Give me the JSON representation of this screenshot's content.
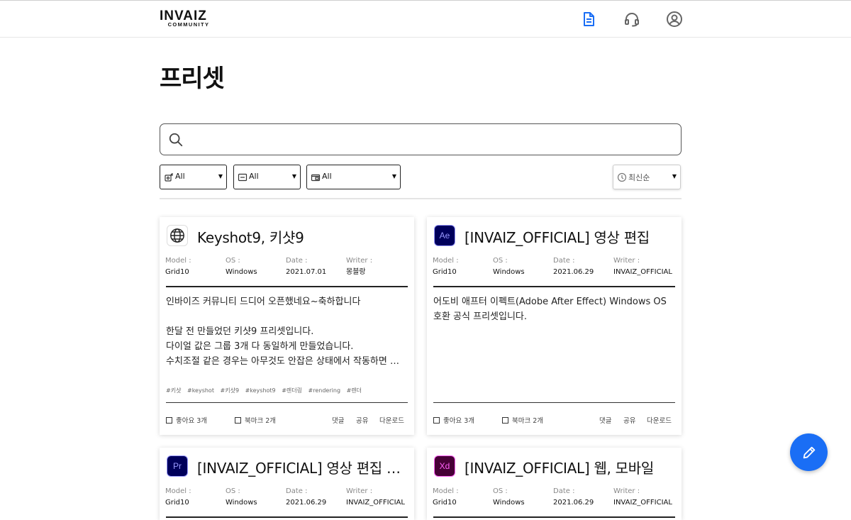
{
  "header": {
    "logo_main": "INVAIZ",
    "logo_sub": "COMMUNITY",
    "icons": [
      "document-icon",
      "headset-icon",
      "user-icon"
    ],
    "accent_color": "#1a6ef5"
  },
  "page": {
    "title": "프리셋"
  },
  "search": {
    "value": "",
    "placeholder": "",
    "icon": "search-icon"
  },
  "filters": [
    {
      "icon": "device-icon",
      "label": "All"
    },
    {
      "icon": "window-icon",
      "label": "All"
    },
    {
      "icon": "folder-icon",
      "label": "All"
    }
  ],
  "sort": {
    "icon": "clock-icon",
    "label": "최신순"
  },
  "meta_labels": {
    "model": "Model :",
    "os": "OS :",
    "date": "Date :",
    "writer": "Writer :"
  },
  "cards": [
    {
      "icon": "globe-icon",
      "title": "Keyshot9, 키샷9",
      "model": "Grid10",
      "os": "Windows",
      "date": "2021.07.01",
      "writer": "몽블랑",
      "body": [
        "인바이즈 커뮤니티 드디어 오픈했네요~축하합니다",
        "",
        "한달 전 만들었던 키샷9 프리셋입니다.",
        "다이얼 값은 그룹 3개 다 동일하게 만들었습니다.",
        "수치조절 같은 경우는 아무것도 안잡은 상태에서 작동하면 …"
      ],
      "tags": [
        "#키샷",
        "#keyshot",
        "#키샷9",
        "#keyshot9",
        "#렌더링",
        "#rendering",
        "#렌더"
      ],
      "likes": "좋아요 3개",
      "bookmarks": "북마크 2개",
      "comment": "댓글",
      "share": "공유",
      "download": "다운로드"
    },
    {
      "icon": "after-effects-icon",
      "icon_text": "Ae",
      "icon_color": "#9999ff",
      "title": "[INVAIZ_OFFICIAL] 영상 편집",
      "model": "Grid10",
      "os": "Windows",
      "date": "2021.06.29",
      "writer": "INVAIZ_OFFICIAL",
      "body": [
        "어도비 애프터 이펙트(Adobe After Effect) Windows OS",
        "호환 공식 프리셋입니다."
      ],
      "tags": [],
      "likes": "좋아요 3개",
      "bookmarks": "북마크 2개",
      "comment": "댓글",
      "share": "공유",
      "download": "다운로드"
    },
    {
      "icon": "premiere-pro-icon",
      "icon_text": "Pr",
      "icon_color": "#9999ff",
      "title": "[INVAIZ_OFFICIAL] 영상 편집 …",
      "model": "Grid10",
      "os": "Windows",
      "date": "2021.06.29",
      "writer": "INVAIZ_OFFICIAL"
    },
    {
      "icon": "adobe-xd-icon",
      "icon_text": "Xd",
      "icon_color": "#ff61f6",
      "title": "[INVAIZ_OFFICIAL] 웹, 모바일",
      "model": "Grid10",
      "os": "Windows",
      "date": "2021.06.29",
      "writer": "INVAIZ_OFFICIAL"
    }
  ],
  "fab": {
    "icon": "pencil-icon"
  }
}
